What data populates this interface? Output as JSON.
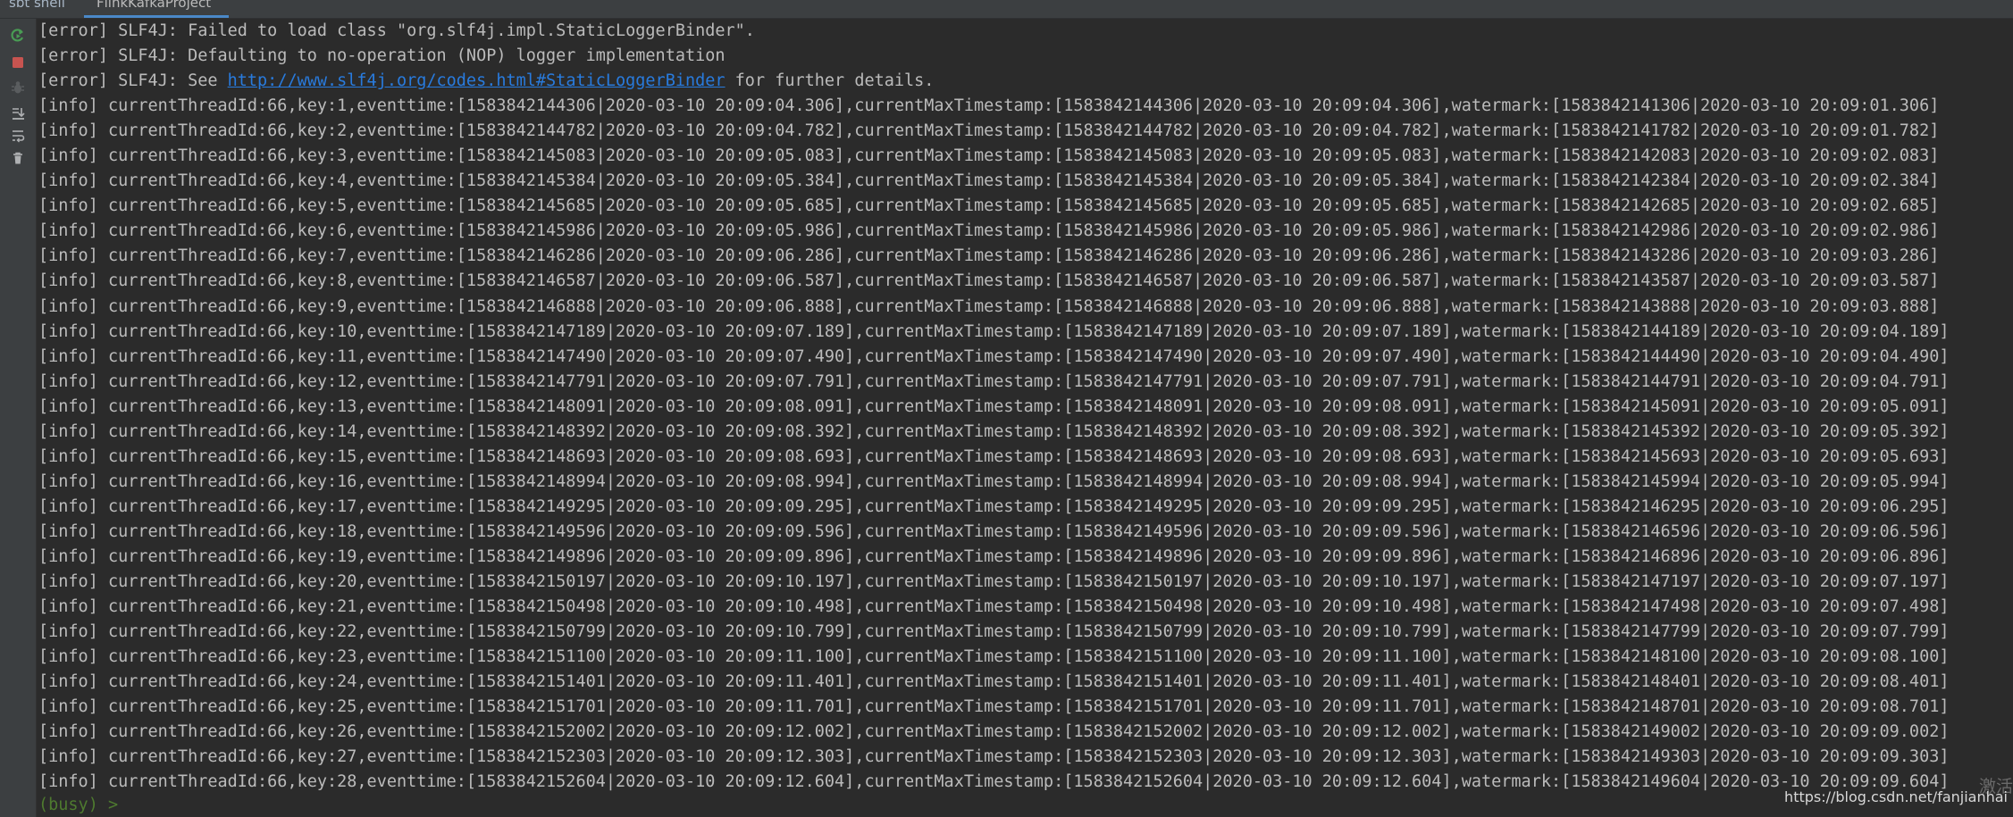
{
  "tabs": [
    {
      "label": "sbt shell"
    },
    {
      "label": "FlinkKafkaProject"
    }
  ],
  "toolbar": {
    "rerun": "rerun-icon",
    "stop": "stop-icon",
    "debug": "debug-icon",
    "scroll_end": "scroll-to-end-icon",
    "soft_wrap": "soft-wrap-icon",
    "clear": "trash-icon"
  },
  "colors": {
    "background": "#2b2b2b",
    "text": "#bbbbbb",
    "link": "#287bde",
    "prompt": "#4e7a2f",
    "tab_accent": "#4a88c7"
  },
  "console": {
    "errors": [
      "[error] SLF4J: Failed to load class \"org.slf4j.impl.StaticLoggerBinder\".",
      "[error] SLF4J: Defaulting to no-operation (NOP) logger implementation"
    ],
    "see_line": {
      "prefix": "[error] SLF4J: See ",
      "link": "http://www.slf4j.org/codes.html#StaticLoggerBinder",
      "suffix": " for further details."
    },
    "info_lines": [
      "[info] currentThreadId:66,key:1,eventtime:[1583842144306|2020-03-10 20:09:04.306],currentMaxTimestamp:[1583842144306|2020-03-10 20:09:04.306],watermark:[1583842141306|2020-03-10 20:09:01.306]",
      "[info] currentThreadId:66,key:2,eventtime:[1583842144782|2020-03-10 20:09:04.782],currentMaxTimestamp:[1583842144782|2020-03-10 20:09:04.782],watermark:[1583842141782|2020-03-10 20:09:01.782]",
      "[info] currentThreadId:66,key:3,eventtime:[1583842145083|2020-03-10 20:09:05.083],currentMaxTimestamp:[1583842145083|2020-03-10 20:09:05.083],watermark:[1583842142083|2020-03-10 20:09:02.083]",
      "[info] currentThreadId:66,key:4,eventtime:[1583842145384|2020-03-10 20:09:05.384],currentMaxTimestamp:[1583842145384|2020-03-10 20:09:05.384],watermark:[1583842142384|2020-03-10 20:09:02.384]",
      "[info] currentThreadId:66,key:5,eventtime:[1583842145685|2020-03-10 20:09:05.685],currentMaxTimestamp:[1583842145685|2020-03-10 20:09:05.685],watermark:[1583842142685|2020-03-10 20:09:02.685]",
      "[info] currentThreadId:66,key:6,eventtime:[1583842145986|2020-03-10 20:09:05.986],currentMaxTimestamp:[1583842145986|2020-03-10 20:09:05.986],watermark:[1583842142986|2020-03-10 20:09:02.986]",
      "[info] currentThreadId:66,key:7,eventtime:[1583842146286|2020-03-10 20:09:06.286],currentMaxTimestamp:[1583842146286|2020-03-10 20:09:06.286],watermark:[1583842143286|2020-03-10 20:09:03.286]",
      "[info] currentThreadId:66,key:8,eventtime:[1583842146587|2020-03-10 20:09:06.587],currentMaxTimestamp:[1583842146587|2020-03-10 20:09:06.587],watermark:[1583842143587|2020-03-10 20:09:03.587]",
      "[info] currentThreadId:66,key:9,eventtime:[1583842146888|2020-03-10 20:09:06.888],currentMaxTimestamp:[1583842146888|2020-03-10 20:09:06.888],watermark:[1583842143888|2020-03-10 20:09:03.888]",
      "[info] currentThreadId:66,key:10,eventtime:[1583842147189|2020-03-10 20:09:07.189],currentMaxTimestamp:[1583842147189|2020-03-10 20:09:07.189],watermark:[1583842144189|2020-03-10 20:09:04.189]",
      "[info] currentThreadId:66,key:11,eventtime:[1583842147490|2020-03-10 20:09:07.490],currentMaxTimestamp:[1583842147490|2020-03-10 20:09:07.490],watermark:[1583842144490|2020-03-10 20:09:04.490]",
      "[info] currentThreadId:66,key:12,eventtime:[1583842147791|2020-03-10 20:09:07.791],currentMaxTimestamp:[1583842147791|2020-03-10 20:09:07.791],watermark:[1583842144791|2020-03-10 20:09:04.791]",
      "[info] currentThreadId:66,key:13,eventtime:[1583842148091|2020-03-10 20:09:08.091],currentMaxTimestamp:[1583842148091|2020-03-10 20:09:08.091],watermark:[1583842145091|2020-03-10 20:09:05.091]",
      "[info] currentThreadId:66,key:14,eventtime:[1583842148392|2020-03-10 20:09:08.392],currentMaxTimestamp:[1583842148392|2020-03-10 20:09:08.392],watermark:[1583842145392|2020-03-10 20:09:05.392]",
      "[info] currentThreadId:66,key:15,eventtime:[1583842148693|2020-03-10 20:09:08.693],currentMaxTimestamp:[1583842148693|2020-03-10 20:09:08.693],watermark:[1583842145693|2020-03-10 20:09:05.693]",
      "[info] currentThreadId:66,key:16,eventtime:[1583842148994|2020-03-10 20:09:08.994],currentMaxTimestamp:[1583842148994|2020-03-10 20:09:08.994],watermark:[1583842145994|2020-03-10 20:09:05.994]",
      "[info] currentThreadId:66,key:17,eventtime:[1583842149295|2020-03-10 20:09:09.295],currentMaxTimestamp:[1583842149295|2020-03-10 20:09:09.295],watermark:[1583842146295|2020-03-10 20:09:06.295]",
      "[info] currentThreadId:66,key:18,eventtime:[1583842149596|2020-03-10 20:09:09.596],currentMaxTimestamp:[1583842149596|2020-03-10 20:09:09.596],watermark:[1583842146596|2020-03-10 20:09:06.596]",
      "[info] currentThreadId:66,key:19,eventtime:[1583842149896|2020-03-10 20:09:09.896],currentMaxTimestamp:[1583842149896|2020-03-10 20:09:09.896],watermark:[1583842146896|2020-03-10 20:09:06.896]",
      "[info] currentThreadId:66,key:20,eventtime:[1583842150197|2020-03-10 20:09:10.197],currentMaxTimestamp:[1583842150197|2020-03-10 20:09:10.197],watermark:[1583842147197|2020-03-10 20:09:07.197]",
      "[info] currentThreadId:66,key:21,eventtime:[1583842150498|2020-03-10 20:09:10.498],currentMaxTimestamp:[1583842150498|2020-03-10 20:09:10.498],watermark:[1583842147498|2020-03-10 20:09:07.498]",
      "[info] currentThreadId:66,key:22,eventtime:[1583842150799|2020-03-10 20:09:10.799],currentMaxTimestamp:[1583842150799|2020-03-10 20:09:10.799],watermark:[1583842147799|2020-03-10 20:09:07.799]",
      "[info] currentThreadId:66,key:23,eventtime:[1583842151100|2020-03-10 20:09:11.100],currentMaxTimestamp:[1583842151100|2020-03-10 20:09:11.100],watermark:[1583842148100|2020-03-10 20:09:08.100]",
      "[info] currentThreadId:66,key:24,eventtime:[1583842151401|2020-03-10 20:09:11.401],currentMaxTimestamp:[1583842151401|2020-03-10 20:09:11.401],watermark:[1583842148401|2020-03-10 20:09:08.401]",
      "[info] currentThreadId:66,key:25,eventtime:[1583842151701|2020-03-10 20:09:11.701],currentMaxTimestamp:[1583842151701|2020-03-10 20:09:11.701],watermark:[1583842148701|2020-03-10 20:09:08.701]",
      "[info] currentThreadId:66,key:26,eventtime:[1583842152002|2020-03-10 20:09:12.002],currentMaxTimestamp:[1583842152002|2020-03-10 20:09:12.002],watermark:[1583842149002|2020-03-10 20:09:09.002]",
      "[info] currentThreadId:66,key:27,eventtime:[1583842152303|2020-03-10 20:09:12.303],currentMaxTimestamp:[1583842152303|2020-03-10 20:09:12.303],watermark:[1583842149303|2020-03-10 20:09:09.303]",
      "[info] currentThreadId:66,key:28,eventtime:[1583842152604|2020-03-10 20:09:12.604],currentMaxTimestamp:[1583842152604|2020-03-10 20:09:12.604],watermark:[1583842149604|2020-03-10 20:09:09.604]"
    ],
    "prompt": "(busy) >"
  },
  "watermark": {
    "cjk": "激活",
    "url": "https://blog.csdn.net/fanjianhai"
  }
}
